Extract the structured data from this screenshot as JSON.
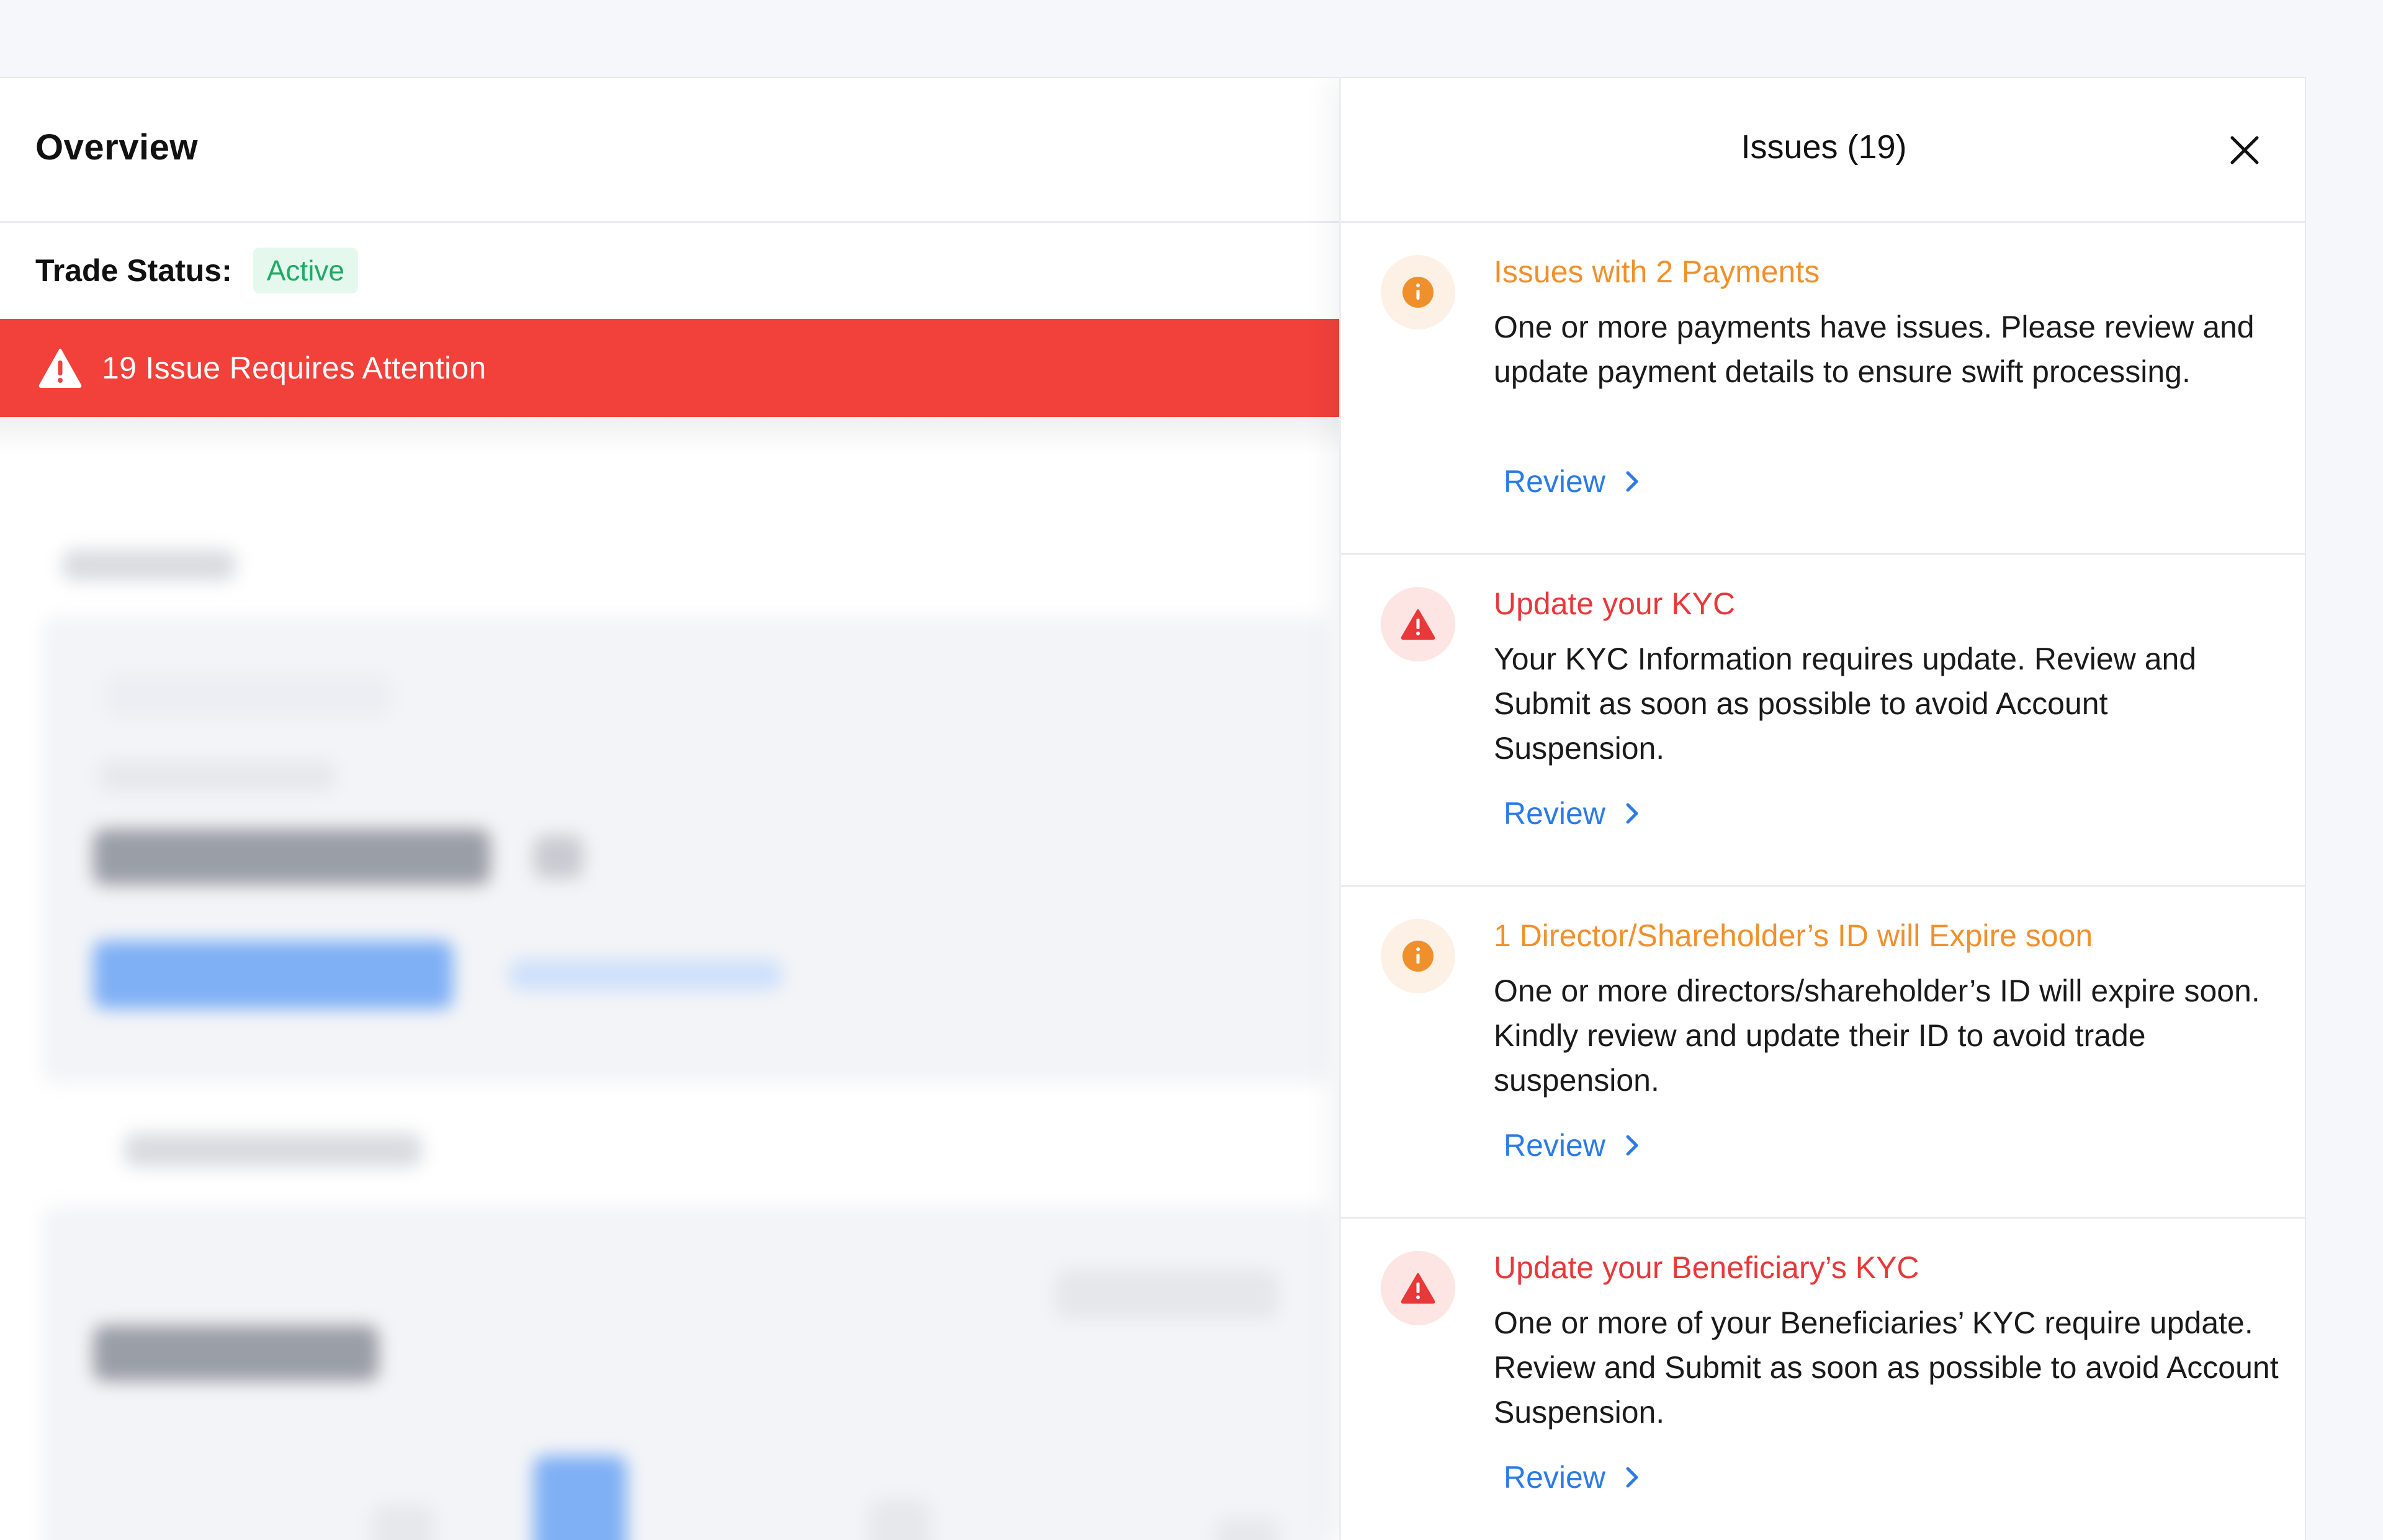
{
  "overview": {
    "title": "Overview",
    "trade_status_label": "Trade Status:",
    "trade_status_value": "Active",
    "alert_text": "19 Issue Requires Attention"
  },
  "panel": {
    "title": "Issues (19)",
    "issues": [
      {
        "severity": "warning",
        "title": "Issues with 2 Payments",
        "description": "One or more payments have issues. Please review and update payment details to ensure swift processing.",
        "action": "Review"
      },
      {
        "severity": "error",
        "title": "Update your KYC",
        "description": "Your KYC Information requires update. Review and Submit as soon as possible to avoid Account Suspension.",
        "action": "Review"
      },
      {
        "severity": "warning",
        "title": "1 Director/Shareholder’s ID will Expire soon",
        "description": "One or more directors/shareholder’s ID will expire soon. Kindly review and update their ID to avoid trade suspension.",
        "action": "Review"
      },
      {
        "severity": "error",
        "title": "Update your Beneficiary’s KYC",
        "description": "One or more of your Beneficiaries’ KYC require update. Review and Submit as soon as possible to avoid Account Suspension.",
        "action": "Review"
      }
    ]
  },
  "colors": {
    "alert_red": "#f2403a",
    "warning_orange": "#f0902c",
    "error_red": "#e8383a",
    "link_blue": "#2c7be5",
    "active_green": "#1faa65"
  },
  "icons": {
    "warning": "info-circle-icon",
    "error": "warning-triangle-icon",
    "close": "close-icon",
    "review": "chevron-right-icon"
  }
}
